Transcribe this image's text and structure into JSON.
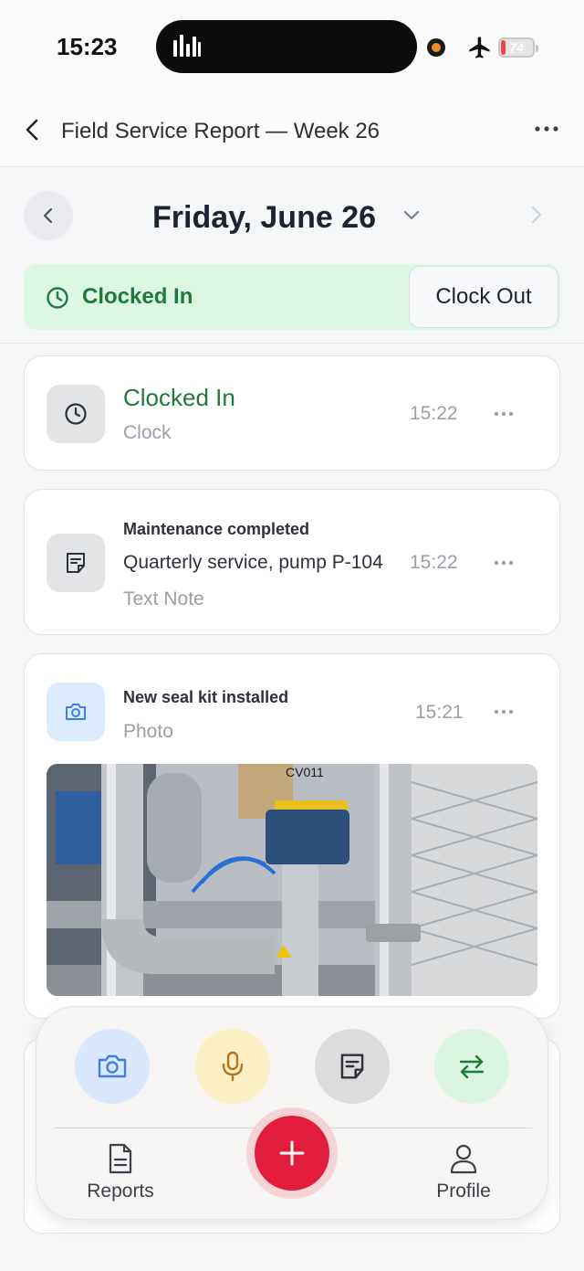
{
  "status_bar": {
    "time": "15:23",
    "battery": "74"
  },
  "nav": {
    "title": "Field Service Report — Week 26"
  },
  "date": {
    "label": "Friday, June 26"
  },
  "clock_banner": {
    "status": "Clocked In",
    "action": "Clock Out"
  },
  "entries": [
    {
      "title": "Clocked In",
      "type": "Clock",
      "time": "15:22",
      "icon": "clock-icon"
    },
    {
      "title": "Maintenance completed",
      "body": "Quarterly service, pump P-104",
      "type": "Text Note",
      "time": "15:22",
      "icon": "note-icon"
    },
    {
      "title": "New seal kit installed",
      "type": "Photo",
      "time": "15:21",
      "icon": "camera-icon",
      "photo_label": "CV011"
    }
  ],
  "dock": {
    "quick_actions": [
      "camera-icon",
      "microphone-icon",
      "note-icon",
      "swap-icon"
    ],
    "tabs": {
      "reports": "Reports",
      "profile": "Profile"
    },
    "fab_icon": "plus-icon"
  },
  "colors": {
    "accent_green": "#1f7a3a",
    "fab_red": "#e21d3c",
    "banner_green": "#dcf7e3"
  }
}
